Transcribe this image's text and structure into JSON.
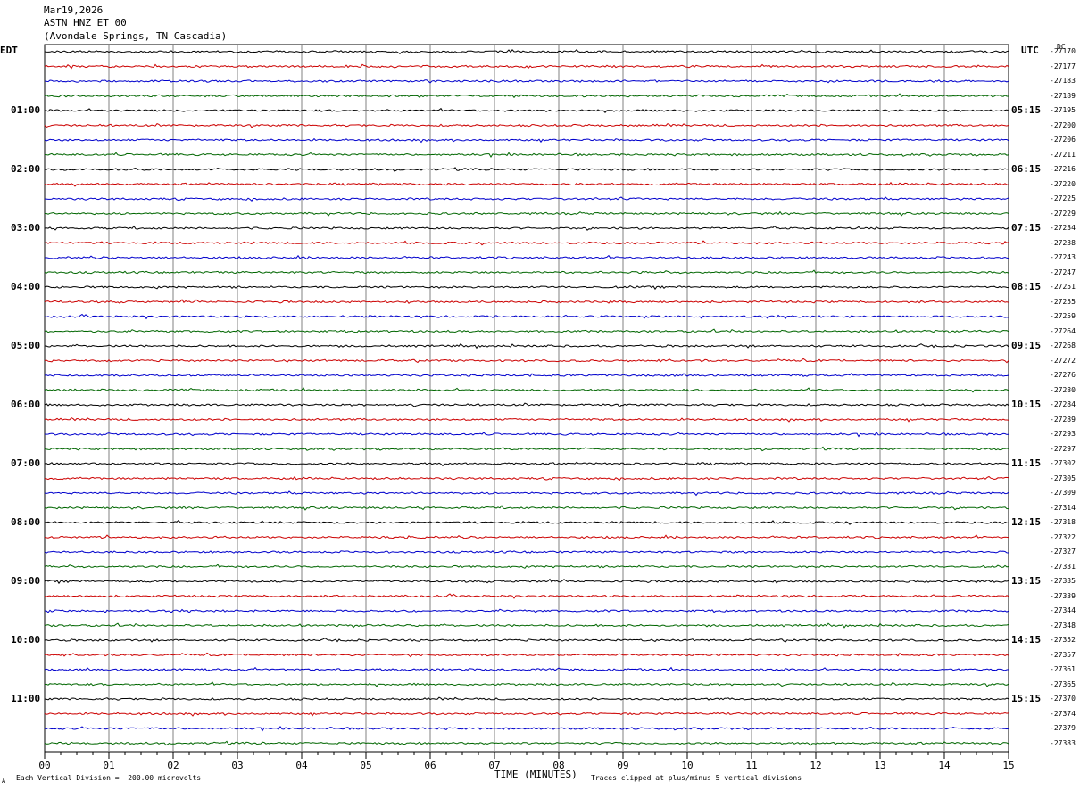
{
  "header": {
    "date": "Mar19,2026",
    "station": "ASTN HNZ ET 00",
    "location": "(Avondale Springs, TN Cascadia)"
  },
  "left_timezone": "EDT",
  "right_timezone": "UTC",
  "dc_label": "DC",
  "footer": {
    "scale": "Each Vertical Division =  200.00 microvolts",
    "clip": "Traces clipped at plus/minus 5 vertical divisions",
    "mark": "A"
  },
  "colors": {
    "trace_cycle": [
      "#000000",
      "#cc0000",
      "#0000cc",
      "#006600"
    ],
    "grid": "#808080"
  },
  "chart_data": {
    "type": "line",
    "xlabel": "TIME (MINUTES)",
    "xlim": [
      0,
      15
    ],
    "x_ticks": [
      "00",
      "01",
      "02",
      "03",
      "04",
      "05",
      "06",
      "07",
      "08",
      "09",
      "10",
      "11",
      "12",
      "13",
      "14",
      "15"
    ],
    "left_hour_labels": [
      "01:00",
      "02:00",
      "03:00",
      "04:00",
      "05:00",
      "06:00",
      "07:00",
      "08:00",
      "09:00",
      "10:00",
      "11:00"
    ],
    "right_hour_labels": [
      "05:15",
      "06:15",
      "07:15",
      "08:15",
      "09:15",
      "10:15",
      "11:15",
      "12:15",
      "13:15",
      "14:15",
      "15:15"
    ],
    "trace_dc_offsets": [
      "-27170",
      "-27177",
      "-27183",
      "-27189",
      "-27195",
      "-27200",
      "-27206",
      "-27211",
      "-27216",
      "-27220",
      "-27225",
      "-27229",
      "-27234",
      "-27238",
      "-27243",
      "-27247",
      "-27251",
      "-27255",
      "-27259",
      "-27264",
      "-27268",
      "-27272",
      "-27276",
      "-27280",
      "-27284",
      "-27289",
      "-27293",
      "-27297",
      "-27302",
      "-27305",
      "-27309",
      "-27314",
      "-27318",
      "-27322",
      "-27327",
      "-27331",
      "-27335",
      "-27339",
      "-27344",
      "-27348",
      "-27352",
      "-27357",
      "-27361",
      "-27365",
      "-27370",
      "-27374",
      "-27379",
      "-27383"
    ],
    "grid": true
  }
}
